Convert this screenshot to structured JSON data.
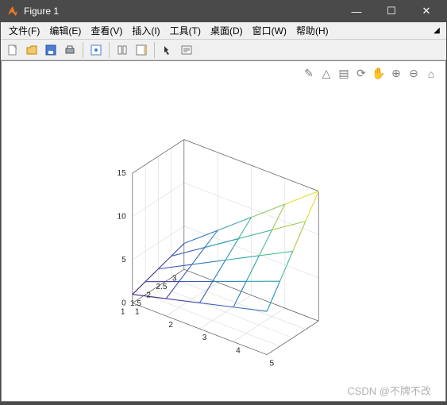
{
  "window": {
    "title": "Figure 1"
  },
  "menus": [
    "文件(F)",
    "编辑(E)",
    "查看(V)",
    "插入(I)",
    "工具(T)",
    "桌面(D)",
    "窗口(W)",
    "帮助(H)"
  ],
  "toolbar": [
    {
      "name": "new-icon"
    },
    {
      "name": "open-icon"
    },
    {
      "name": "save-icon"
    },
    {
      "name": "print-icon"
    },
    {
      "sep": true
    },
    {
      "name": "edit-plot-icon"
    },
    {
      "sep": true
    },
    {
      "name": "link-icon"
    },
    {
      "name": "colorbar-icon"
    },
    {
      "sep": true
    },
    {
      "name": "arrow-icon"
    },
    {
      "name": "insert-text-icon"
    }
  ],
  "plot_tools": [
    {
      "name": "brush-icon",
      "label": "✎"
    },
    {
      "name": "roi-icon",
      "label": "△"
    },
    {
      "name": "data-tips-icon",
      "label": "▤"
    },
    {
      "name": "rotate-icon",
      "label": "⟳"
    },
    {
      "name": "pan-icon",
      "label": "✋"
    },
    {
      "name": "zoom-in-icon",
      "label": "⊕"
    },
    {
      "name": "zoom-out-icon",
      "label": "⊖"
    },
    {
      "name": "restore-view-icon",
      "label": "⌂"
    }
  ],
  "watermark": "CSDN @不牌不改",
  "chart_data": {
    "type": "surface_mesh_3d",
    "title": "",
    "x": [
      1,
      2,
      3,
      4,
      5
    ],
    "y": [
      1,
      1.5,
      2,
      2.5,
      3
    ],
    "z_formula": "x * y",
    "z": [
      [
        1.0,
        1.5,
        2.0,
        2.5,
        3.0
      ],
      [
        2.0,
        3.0,
        4.0,
        5.0,
        6.0
      ],
      [
        3.0,
        4.5,
        6.0,
        7.5,
        9.0
      ],
      [
        4.0,
        6.0,
        8.0,
        10.0,
        12.0
      ],
      [
        5.0,
        7.5,
        10.0,
        12.5,
        15.0
      ]
    ],
    "xlabel": "",
    "ylabel": "",
    "zlabel": "",
    "xticks": [
      1,
      2,
      3,
      4,
      5
    ],
    "yticks": [
      1,
      1.5,
      2,
      2.5,
      3
    ],
    "zticks": [
      0,
      5,
      10,
      15
    ],
    "xlim": [
      1,
      5
    ],
    "ylim": [
      1,
      3
    ],
    "zlim": [
      0,
      15
    ],
    "colormap": "parula",
    "view": {
      "az": -37.5,
      "el": 30
    }
  }
}
